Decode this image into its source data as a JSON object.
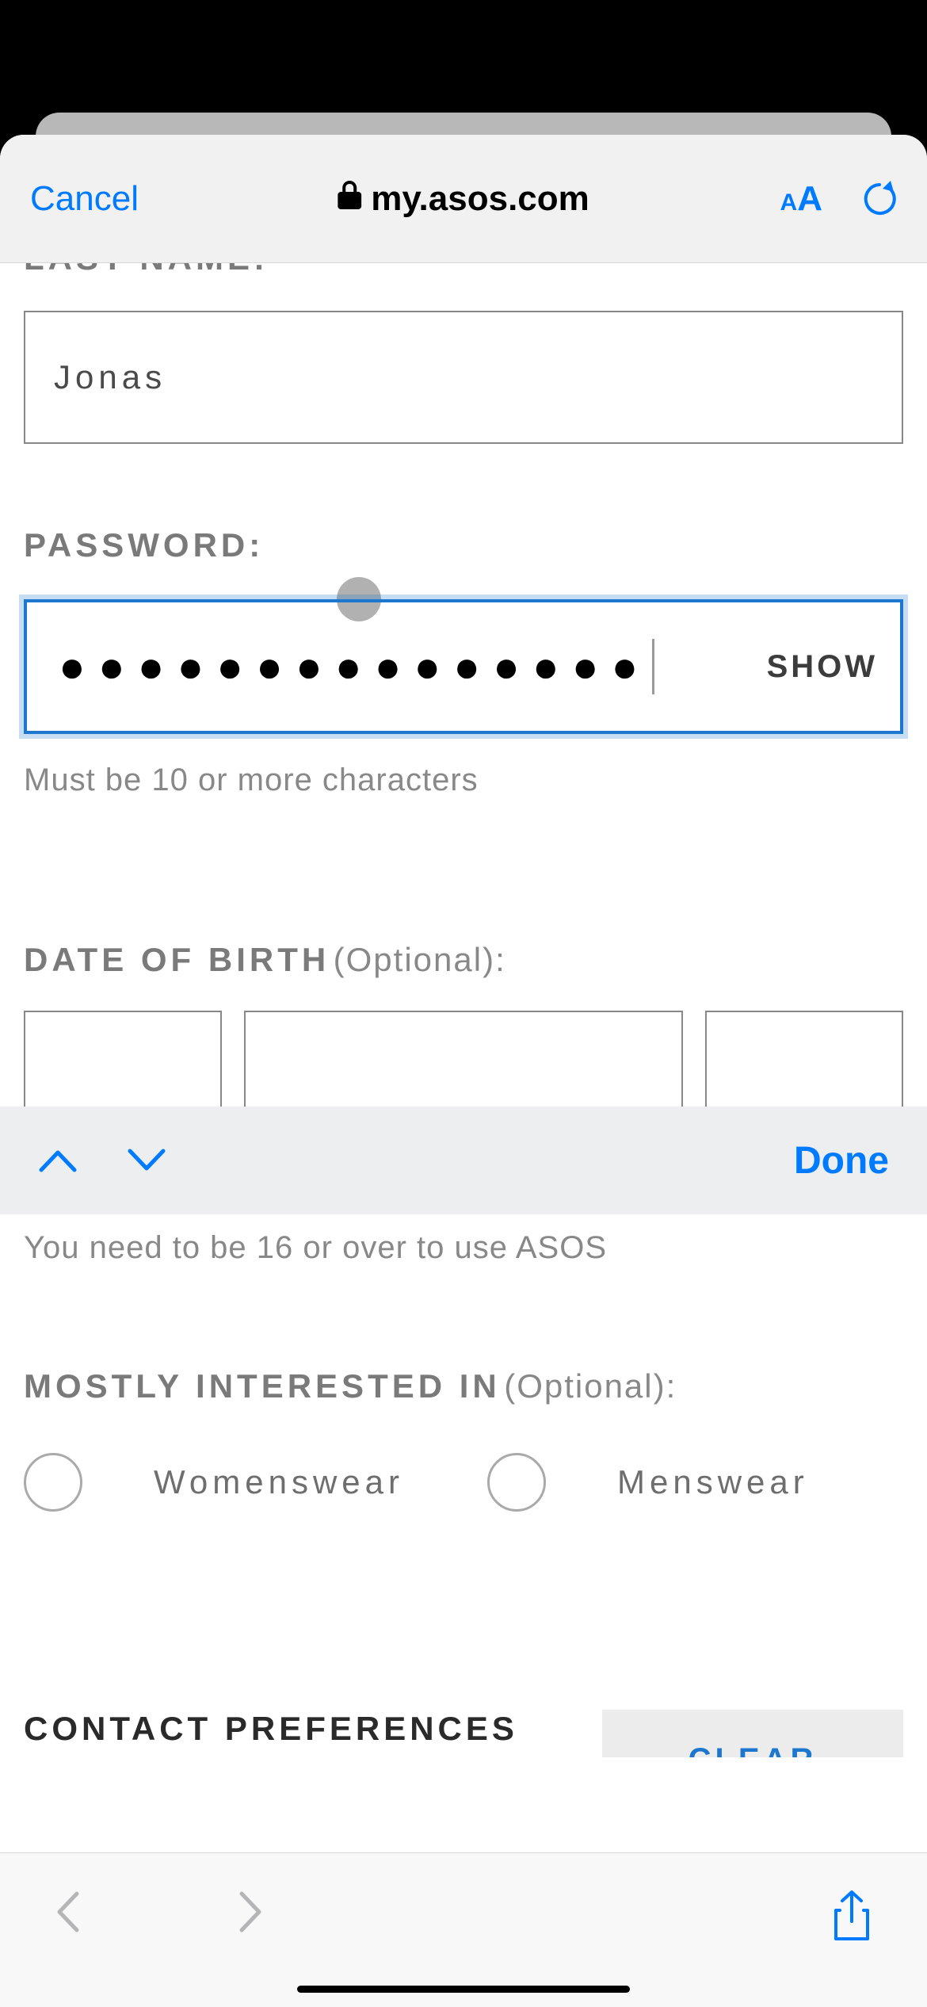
{
  "browser": {
    "cancel": "Cancel",
    "url": "my.asos.com",
    "done": "Done"
  },
  "form": {
    "last_name_label": "LAST NAME:",
    "last_name_value": "Jonas",
    "password_label": "PASSWORD:",
    "password_dots": "●●●●●●●●●●●●●●●",
    "show_label": "SHOW",
    "password_hint": "Must be 10 or more characters",
    "dob_label": "DATE OF BIRTH",
    "dob_optional": "(Optional):",
    "age_hint": "You need to be 16 or over to use ASOS",
    "interest_label": "MOSTLY INTERESTED IN",
    "interest_optional": "(Optional):",
    "womenswear": "Womenswear",
    "menswear": "Menswear",
    "contact_label": "CONTACT PREFERENCES",
    "clear_label": "CLEAR"
  }
}
